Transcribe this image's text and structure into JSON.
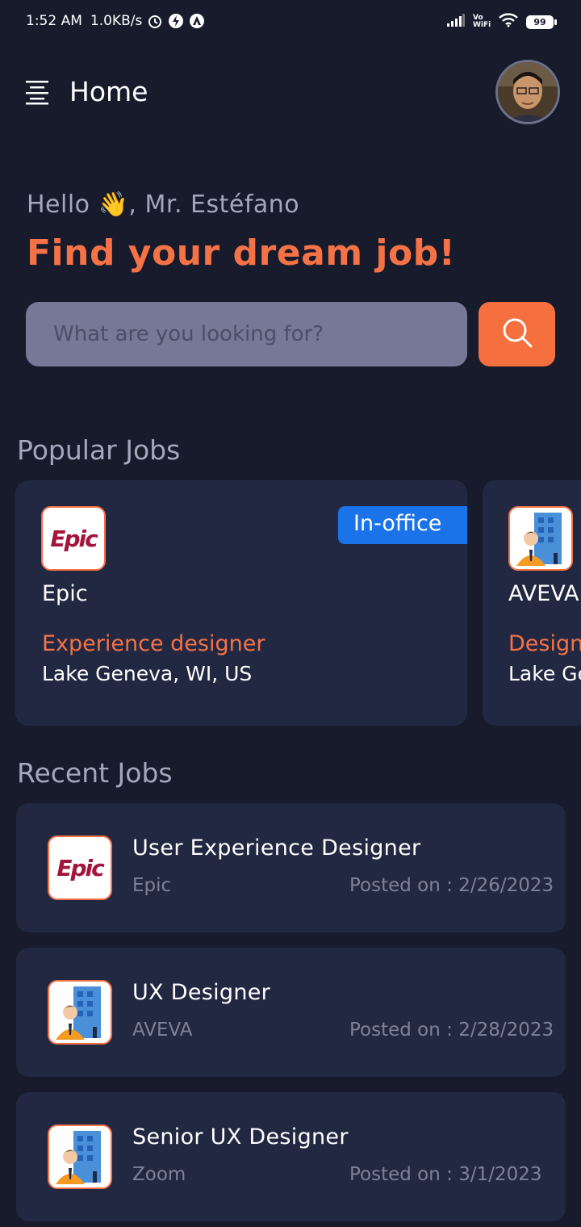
{
  "status_bar": {
    "time": "1:52 AM",
    "speed": "1.0KB/s",
    "network": "Vo WiFi",
    "battery": "99"
  },
  "header": {
    "title": "Home"
  },
  "greeting": {
    "hello": "Hello 👋, Mr. Estéfano",
    "headline": "Find your dream job!"
  },
  "search": {
    "placeholder": "What are you looking for?"
  },
  "popular": {
    "section_title": "Popular Jobs",
    "cards": [
      {
        "logo": "Epic",
        "badge": "In-office",
        "company": "Epic",
        "title": "Experience designer",
        "location": "Lake Geneva, WI, US"
      },
      {
        "logo": "building-person-icon",
        "company": "AVEVA",
        "title": "Designer",
        "location": "Lake Geneva, WI, US"
      }
    ]
  },
  "recent": {
    "section_title": "Recent Jobs",
    "items": [
      {
        "logo": "Epic",
        "title": "User Experience Designer",
        "company": "Epic",
        "posted": "Posted on :  2/26/2023"
      },
      {
        "logo": "building-person-icon",
        "title": "UX Designer",
        "company": "AVEVA",
        "posted": "Posted on :  2/28/2023"
      },
      {
        "logo": "building-person-icon",
        "title": "Senior UX Designer",
        "company": "Zoom",
        "posted": "Posted on :  3/1/2023"
      }
    ]
  },
  "colors": {
    "background": "#171b2c",
    "card": "#232842",
    "accent": "#f47246",
    "badge": "#1a73e8"
  }
}
